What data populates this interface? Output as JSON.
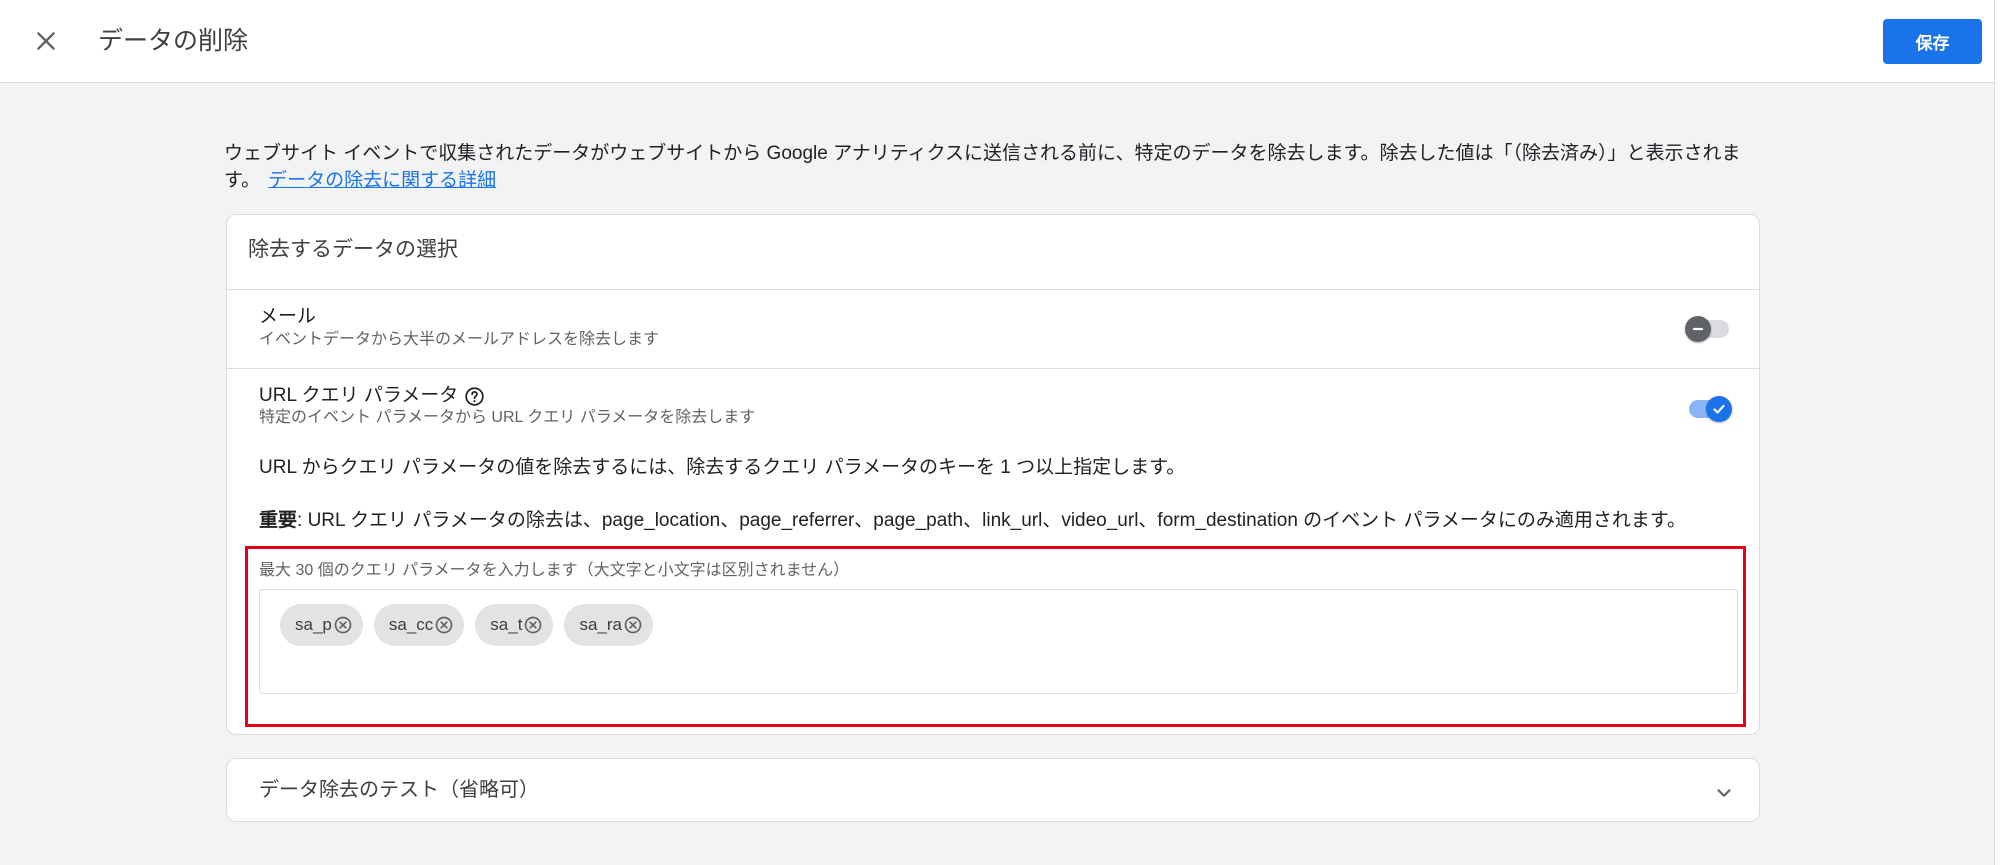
{
  "header": {
    "close_icon": "close-icon",
    "title": "データの削除",
    "save_label": "保存"
  },
  "intro": {
    "text": "ウェブサイト イベントで収集されたデータがウェブサイトから Google アナリティクスに送信される前に、特定のデータを除去します。除去した値は「（除去済み）」と表示されます。",
    "link": "データの除去に関する詳細"
  },
  "filter_card": {
    "title": "除去するデータの選択",
    "email": {
      "title": "メール",
      "description": "イベントデータから大半のメールアドレスを除去します",
      "enabled": false
    },
    "url_query": {
      "title": "URL クエリ パラメータ",
      "help_icon": "help-icon",
      "description": "特定のイベント パラメータから URL クエリ パラメータを除去します",
      "enabled": true,
      "instruction": "URL からクエリ パラメータの値を除去するには、除去するクエリ パラメータのキーを 1 つ以上指定します。",
      "important_label": "重要",
      "important_text": ": URL クエリ パラメータの除去は、page_location、page_referrer、page_path、link_url、video_url、form_destination のイベント パラメータにのみ適用されます。",
      "params_label": "最大 30 個のクエリ パラメータを入力します（大文字と小文字は区別されません）",
      "params": [
        "sa_p",
        "sa_cc",
        "sa_t",
        "sa_ra"
      ],
      "chip_remove_icon": "cancel-icon"
    }
  },
  "test_card": {
    "title": "データ除去のテスト（省略可）",
    "expand_icon": "chevron-down-icon"
  },
  "colors": {
    "accent": "#1a73e8",
    "highlight_border": "#e60012"
  }
}
